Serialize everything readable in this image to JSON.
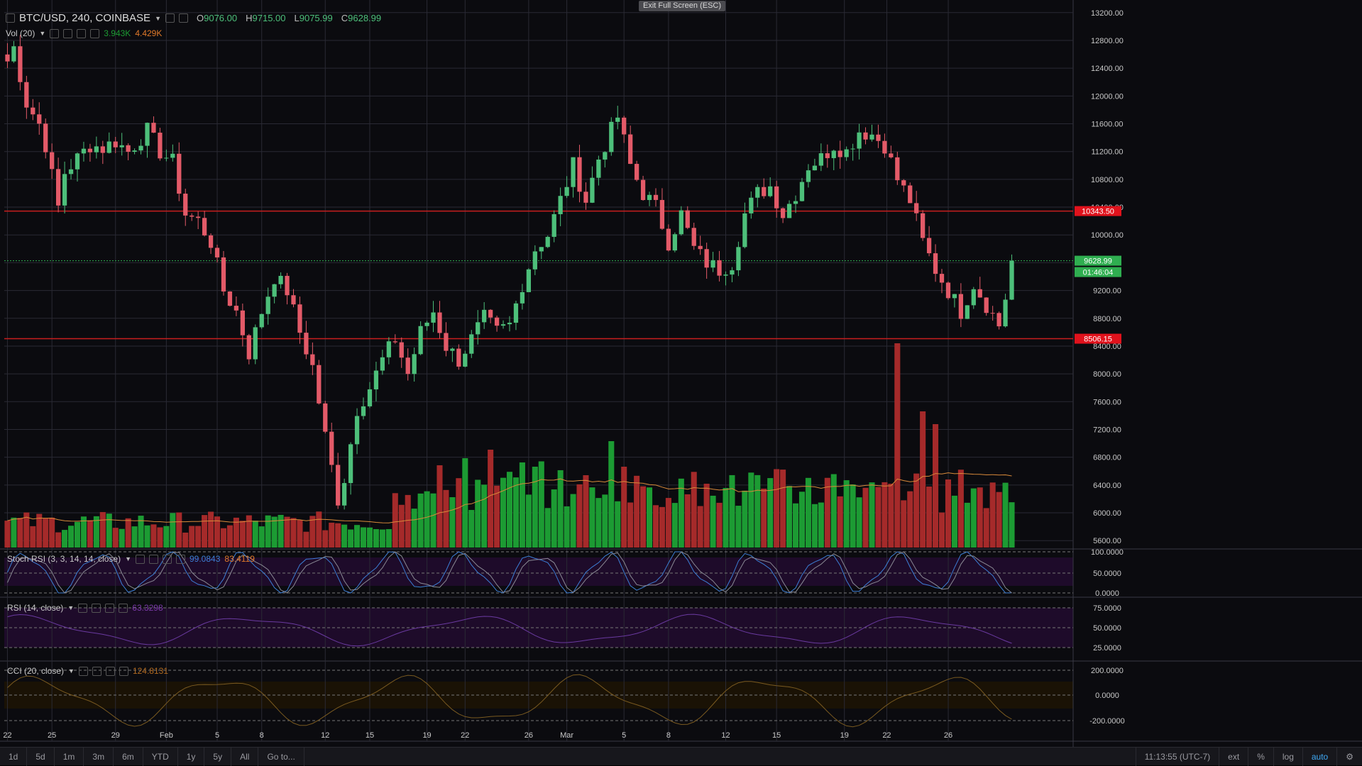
{
  "header": {
    "symbol": "BTC/USD, 240, COINBASE",
    "open_label": "O",
    "open": "9076.00",
    "high_label": "H",
    "high": "9715.00",
    "low_label": "L",
    "low": "9075.99",
    "close_label": "C",
    "close": "9628.99",
    "fullscreen_exit": "Exit Full Screen (ESC)"
  },
  "indicators": {
    "volume": {
      "label": "Vol (20)",
      "value1": "3.943K",
      "value2": "4.429K"
    },
    "stoch_rsi": {
      "label": "Stoch RSI (3, 3, 14, 14, close)",
      "value1": "99.0843",
      "value2": "83.4119"
    },
    "rsi": {
      "label": "RSI (14, close)",
      "value1": "63.3298"
    },
    "cci": {
      "label": "CCI (20, close)",
      "value1": "124.8131"
    }
  },
  "price_axis": {
    "ticks": [
      "13200.00",
      "12800.00",
      "12400.00",
      "12000.00",
      "11600.00",
      "11200.00",
      "10800.00",
      "10400.00",
      "10000.00",
      "9600.00",
      "9200.00",
      "8800.00",
      "8400.00",
      "8000.00",
      "7600.00",
      "7200.00",
      "6800.00",
      "6400.00",
      "6000.00",
      "5600.00"
    ],
    "resistance": "10343.50",
    "support": "8506.15",
    "last_price": "9628.99",
    "countdown": "01:46:04"
  },
  "stoch_axis": {
    "ticks": [
      "100.0000",
      "50.0000",
      "0.0000"
    ]
  },
  "rsi_axis": {
    "ticks": [
      "75.0000",
      "50.0000",
      "25.0000"
    ]
  },
  "cci_axis": {
    "ticks": [
      "200.0000",
      "0.0000",
      "-200.0000"
    ]
  },
  "time_axis": {
    "labels": [
      "22",
      "25",
      "29",
      "Feb",
      "5",
      "8",
      "12",
      "15",
      "19",
      "22",
      "26",
      "Mar",
      "5",
      "8",
      "12",
      "15",
      "19",
      "22",
      "26"
    ]
  },
  "bottom_bar": {
    "ranges": [
      "1d",
      "5d",
      "1m",
      "3m",
      "6m",
      "YTD",
      "1y",
      "5y",
      "All"
    ],
    "goto": "Go to...",
    "time": "11:13:55 (UTC-7)",
    "ext": "ext",
    "percent": "%",
    "log": "log",
    "auto": "auto"
  },
  "colors": {
    "bg": "#0b0b0f",
    "grid": "#2a2a34",
    "up": "#4dbf7a",
    "down": "#e35a68",
    "vol_up": "#1c9b33",
    "vol_down": "#a52a2a",
    "hline": "#c81e1e",
    "label_red": "#e0121c",
    "label_green": "#2fae50",
    "pane_purple": "#1e0b2a",
    "stoch_k": "#3d7fd6",
    "stoch_d": "#e07a2a",
    "rsi_line": "#6a3aa0",
    "cci_line": "#7a5a20",
    "ma_line": "#d98a3a"
  },
  "chart_data": {
    "type": "candlestick",
    "ylim": [
      5500,
      13300
    ],
    "price_path": [
      [
        0,
        12500
      ],
      [
        1,
        12700
      ],
      [
        3,
        11900
      ],
      [
        5,
        11600
      ],
      [
        6,
        11300
      ],
      [
        8,
        10400
      ],
      [
        9,
        10900
      ],
      [
        11,
        11100
      ],
      [
        13,
        11300
      ],
      [
        15,
        11250
      ],
      [
        17,
        11350
      ],
      [
        19,
        11200
      ],
      [
        22,
        11500
      ],
      [
        24,
        11200
      ],
      [
        26,
        11050
      ],
      [
        28,
        10300
      ],
      [
        30,
        10200
      ],
      [
        32,
        9900
      ],
      [
        34,
        9200
      ],
      [
        36,
        8900
      ],
      [
        38,
        8300
      ],
      [
        40,
        8900
      ],
      [
        42,
        9400
      ],
      [
        44,
        9200
      ],
      [
        46,
        8600
      ],
      [
        48,
        8100
      ],
      [
        50,
        7100
      ],
      [
        52,
        6200
      ],
      [
        53,
        6500
      ],
      [
        55,
        7500
      ],
      [
        57,
        7800
      ],
      [
        59,
        8200
      ],
      [
        61,
        8500
      ],
      [
        63,
        8000
      ],
      [
        65,
        8600
      ],
      [
        67,
        8900
      ],
      [
        69,
        8400
      ],
      [
        71,
        8200
      ],
      [
        73,
        8500
      ],
      [
        75,
        8800
      ],
      [
        77,
        8600
      ],
      [
        79,
        8700
      ],
      [
        81,
        9300
      ],
      [
        83,
        9800
      ],
      [
        85,
        10000
      ],
      [
        87,
        10500
      ],
      [
        89,
        11000
      ],
      [
        91,
        10500
      ],
      [
        93,
        11100
      ],
      [
        95,
        11500
      ],
      [
        96,
        11700
      ],
      [
        98,
        11000
      ],
      [
        100,
        10600
      ],
      [
        102,
        10400
      ],
      [
        104,
        9900
      ],
      [
        106,
        10300
      ],
      [
        108,
        9800
      ],
      [
        110,
        9600
      ],
      [
        112,
        9500
      ],
      [
        114,
        9600
      ],
      [
        116,
        10300
      ],
      [
        118,
        10600
      ],
      [
        120,
        10700
      ],
      [
        122,
        10300
      ],
      [
        124,
        10600
      ],
      [
        126,
        11000
      ],
      [
        128,
        11100
      ],
      [
        130,
        11300
      ],
      [
        132,
        11200
      ],
      [
        134,
        11500
      ],
      [
        136,
        11450
      ],
      [
        138,
        11300
      ],
      [
        140,
        10800
      ],
      [
        142,
        10500
      ],
      [
        144,
        9900
      ],
      [
        146,
        9500
      ],
      [
        148,
        9200
      ],
      [
        150,
        8900
      ],
      [
        152,
        9300
      ],
      [
        154,
        9000
      ],
      [
        156,
        8700
      ],
      [
        157,
        9100
      ],
      [
        158,
        9629
      ]
    ],
    "volume_spikes": [
      [
        72,
        2.1
      ],
      [
        76,
        2.3
      ],
      [
        81,
        2.0
      ],
      [
        83,
        1.9
      ],
      [
        91,
        1.7
      ],
      [
        95,
        2.5
      ],
      [
        97,
        1.9
      ],
      [
        110,
        1.5
      ],
      [
        113,
        1.4
      ],
      [
        140,
        4.8
      ],
      [
        144,
        3.2
      ],
      [
        146,
        2.9
      ],
      [
        148,
        1.6
      ]
    ],
    "time_positions": [
      0,
      7,
      17,
      25,
      33,
      40,
      50,
      57,
      66,
      72,
      82,
      88,
      97,
      104,
      113,
      121,
      131,
      137,
      146
    ]
  }
}
